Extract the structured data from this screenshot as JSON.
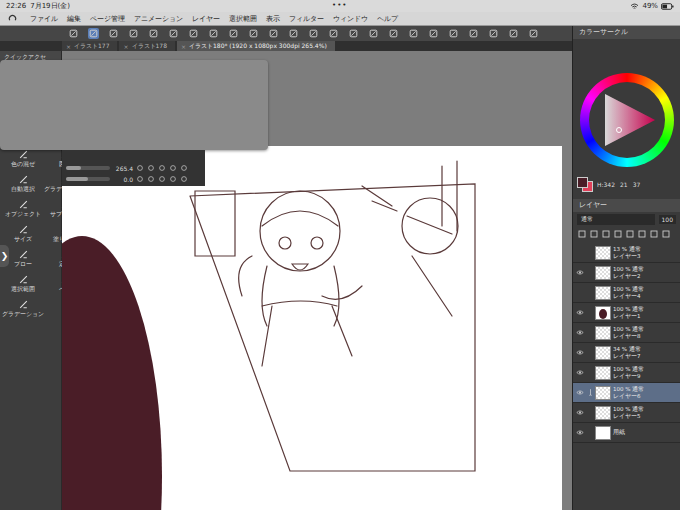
{
  "status_bar": {
    "time": "22:26",
    "date": "7月19日(金)",
    "dots": "•••",
    "battery": "49%"
  },
  "menu": [
    "ファイル",
    "編集",
    "ページ管理",
    "アニメーション",
    "レイヤー",
    "選択範囲",
    "表示",
    "フィルター",
    "ウィンドウ",
    "ヘルプ"
  ],
  "tabs": [
    {
      "label": "イラスト177",
      "selected": false
    },
    {
      "label": "イラスト178",
      "selected": false
    },
    {
      "label": "イラスト180* (1920 x 1080px 300dpi 265.4%)",
      "selected": true
    }
  ],
  "tool_panel": {
    "header": "クイックアクセ",
    "expander": "❯",
    "items": [
      "色の混ぜ",
      "図形",
      "自動選択",
      "グラデーション",
      "オブジェクト",
      "サブツール",
      "サイズ",
      "塗り・色",
      "ブロー",
      "定規",
      "選択範囲",
      "ペン",
      "グラデーション"
    ]
  },
  "tool_property": {
    "rows": [
      {
        "value": "265.4",
        "level": 0.35
      },
      {
        "value": "0.0",
        "level": 0.5
      }
    ]
  },
  "color_panel": {
    "title": "カラーサークル",
    "readings": [
      "H:342",
      "21",
      "37"
    ],
    "colors": [
      {
        "name": "main",
        "color": "#4a1d27"
      },
      {
        "name": "sub",
        "color": "#e0405a"
      }
    ]
  },
  "layer_panel": {
    "title": "レイヤー",
    "blend": "通常",
    "opacity": "100",
    "layers": [
      {
        "opacity": "13 %",
        "mode": "通常",
        "name": "レイヤー3",
        "visible": false,
        "selected": false,
        "kind": "transparent"
      },
      {
        "opacity": "100 %",
        "mode": "通常",
        "name": "レイヤー2",
        "visible": true,
        "selected": false,
        "kind": "transparent"
      },
      {
        "opacity": "100 %",
        "mode": "通常",
        "name": "レイヤー4",
        "visible": false,
        "selected": false,
        "kind": "transparent"
      },
      {
        "opacity": "100 %",
        "mode": "通常",
        "name": "レイヤー1",
        "visible": true,
        "selected": false,
        "kind": "art"
      },
      {
        "opacity": "100 %",
        "mode": "通常",
        "name": "レイヤー8",
        "visible": true,
        "selected": false,
        "kind": "transparent"
      },
      {
        "opacity": "34 %",
        "mode": "通常",
        "name": "レイヤー7",
        "visible": true,
        "selected": false,
        "kind": "transparent"
      },
      {
        "opacity": "100 %",
        "mode": "通常",
        "name": "レイヤー9",
        "visible": true,
        "selected": false,
        "kind": "transparent"
      },
      {
        "opacity": "100 %",
        "mode": "通常",
        "name": "レイヤー6",
        "visible": true,
        "selected": true,
        "kind": "transparent"
      },
      {
        "opacity": "100 %",
        "mode": "通常",
        "name": "レイヤー5",
        "visible": true,
        "selected": false,
        "kind": "transparent"
      },
      {
        "opacity": "",
        "mode": "",
        "name": "用紙",
        "visible": true,
        "selected": false,
        "kind": "paper"
      }
    ]
  }
}
